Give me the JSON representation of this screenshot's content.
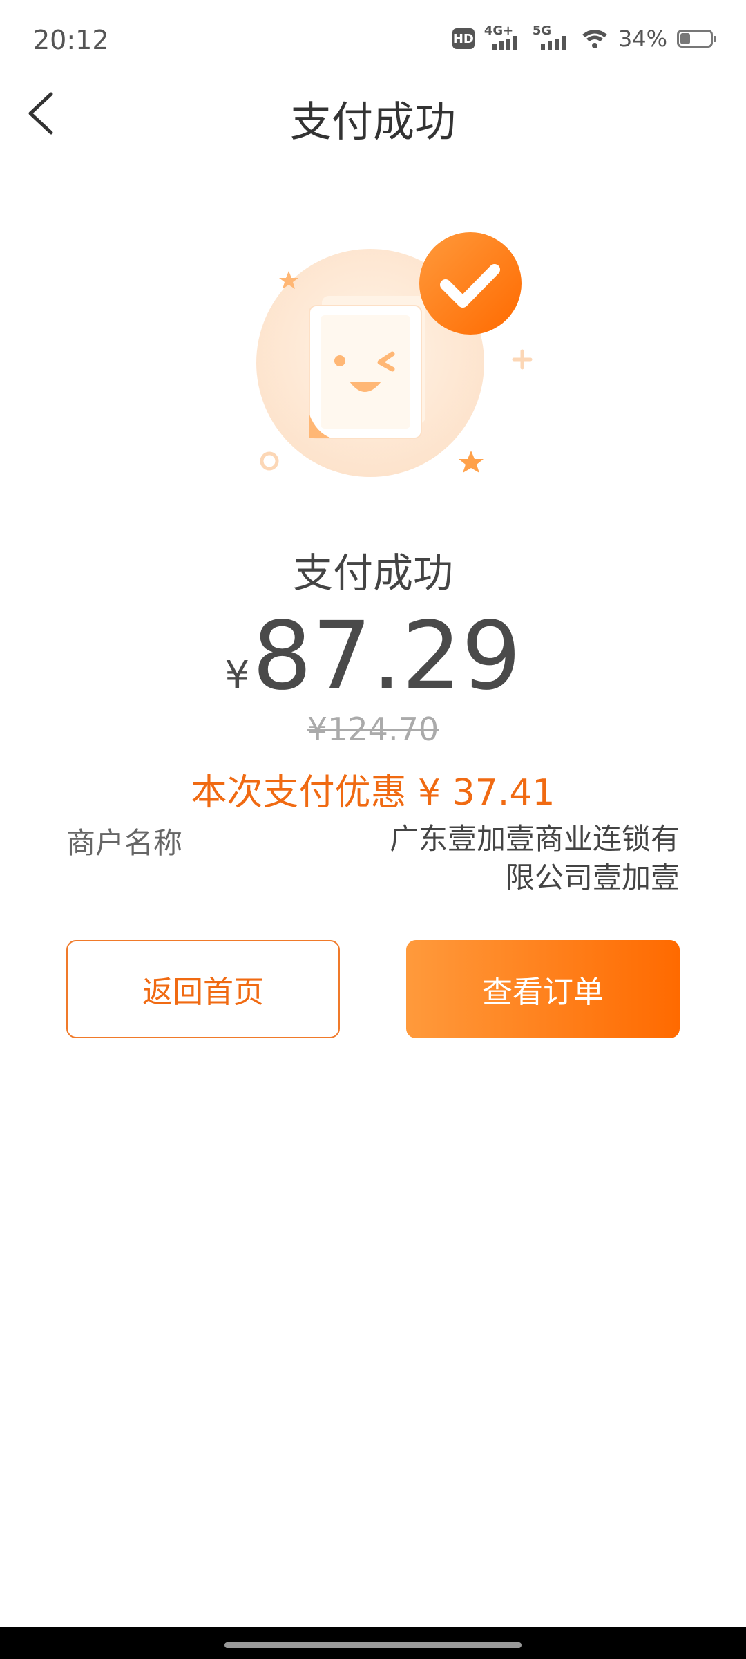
{
  "status_bar": {
    "time": "20:12",
    "hd_label": "HD",
    "sim1_label": "4G+",
    "sim2_label": "5G",
    "battery": "34%",
    "battery_level": 0.34
  },
  "nav": {
    "title": "支付成功",
    "back_icon": "chevron-left-icon"
  },
  "result": {
    "title": "支付成功",
    "currency": "¥",
    "amount": "87.29",
    "original_price": "¥124.70",
    "discount_text": "本次支付优惠 ¥ 37.41"
  },
  "merchant": {
    "label": "商户名称",
    "value": "广东壹加壹商业连锁有限公司壹加壹"
  },
  "buttons": {
    "home": "返回首页",
    "order": "查看订单"
  },
  "colors": {
    "accent": "#ff6a00",
    "accent_light": "#ff9a3c",
    "text_dark": "#333333"
  }
}
